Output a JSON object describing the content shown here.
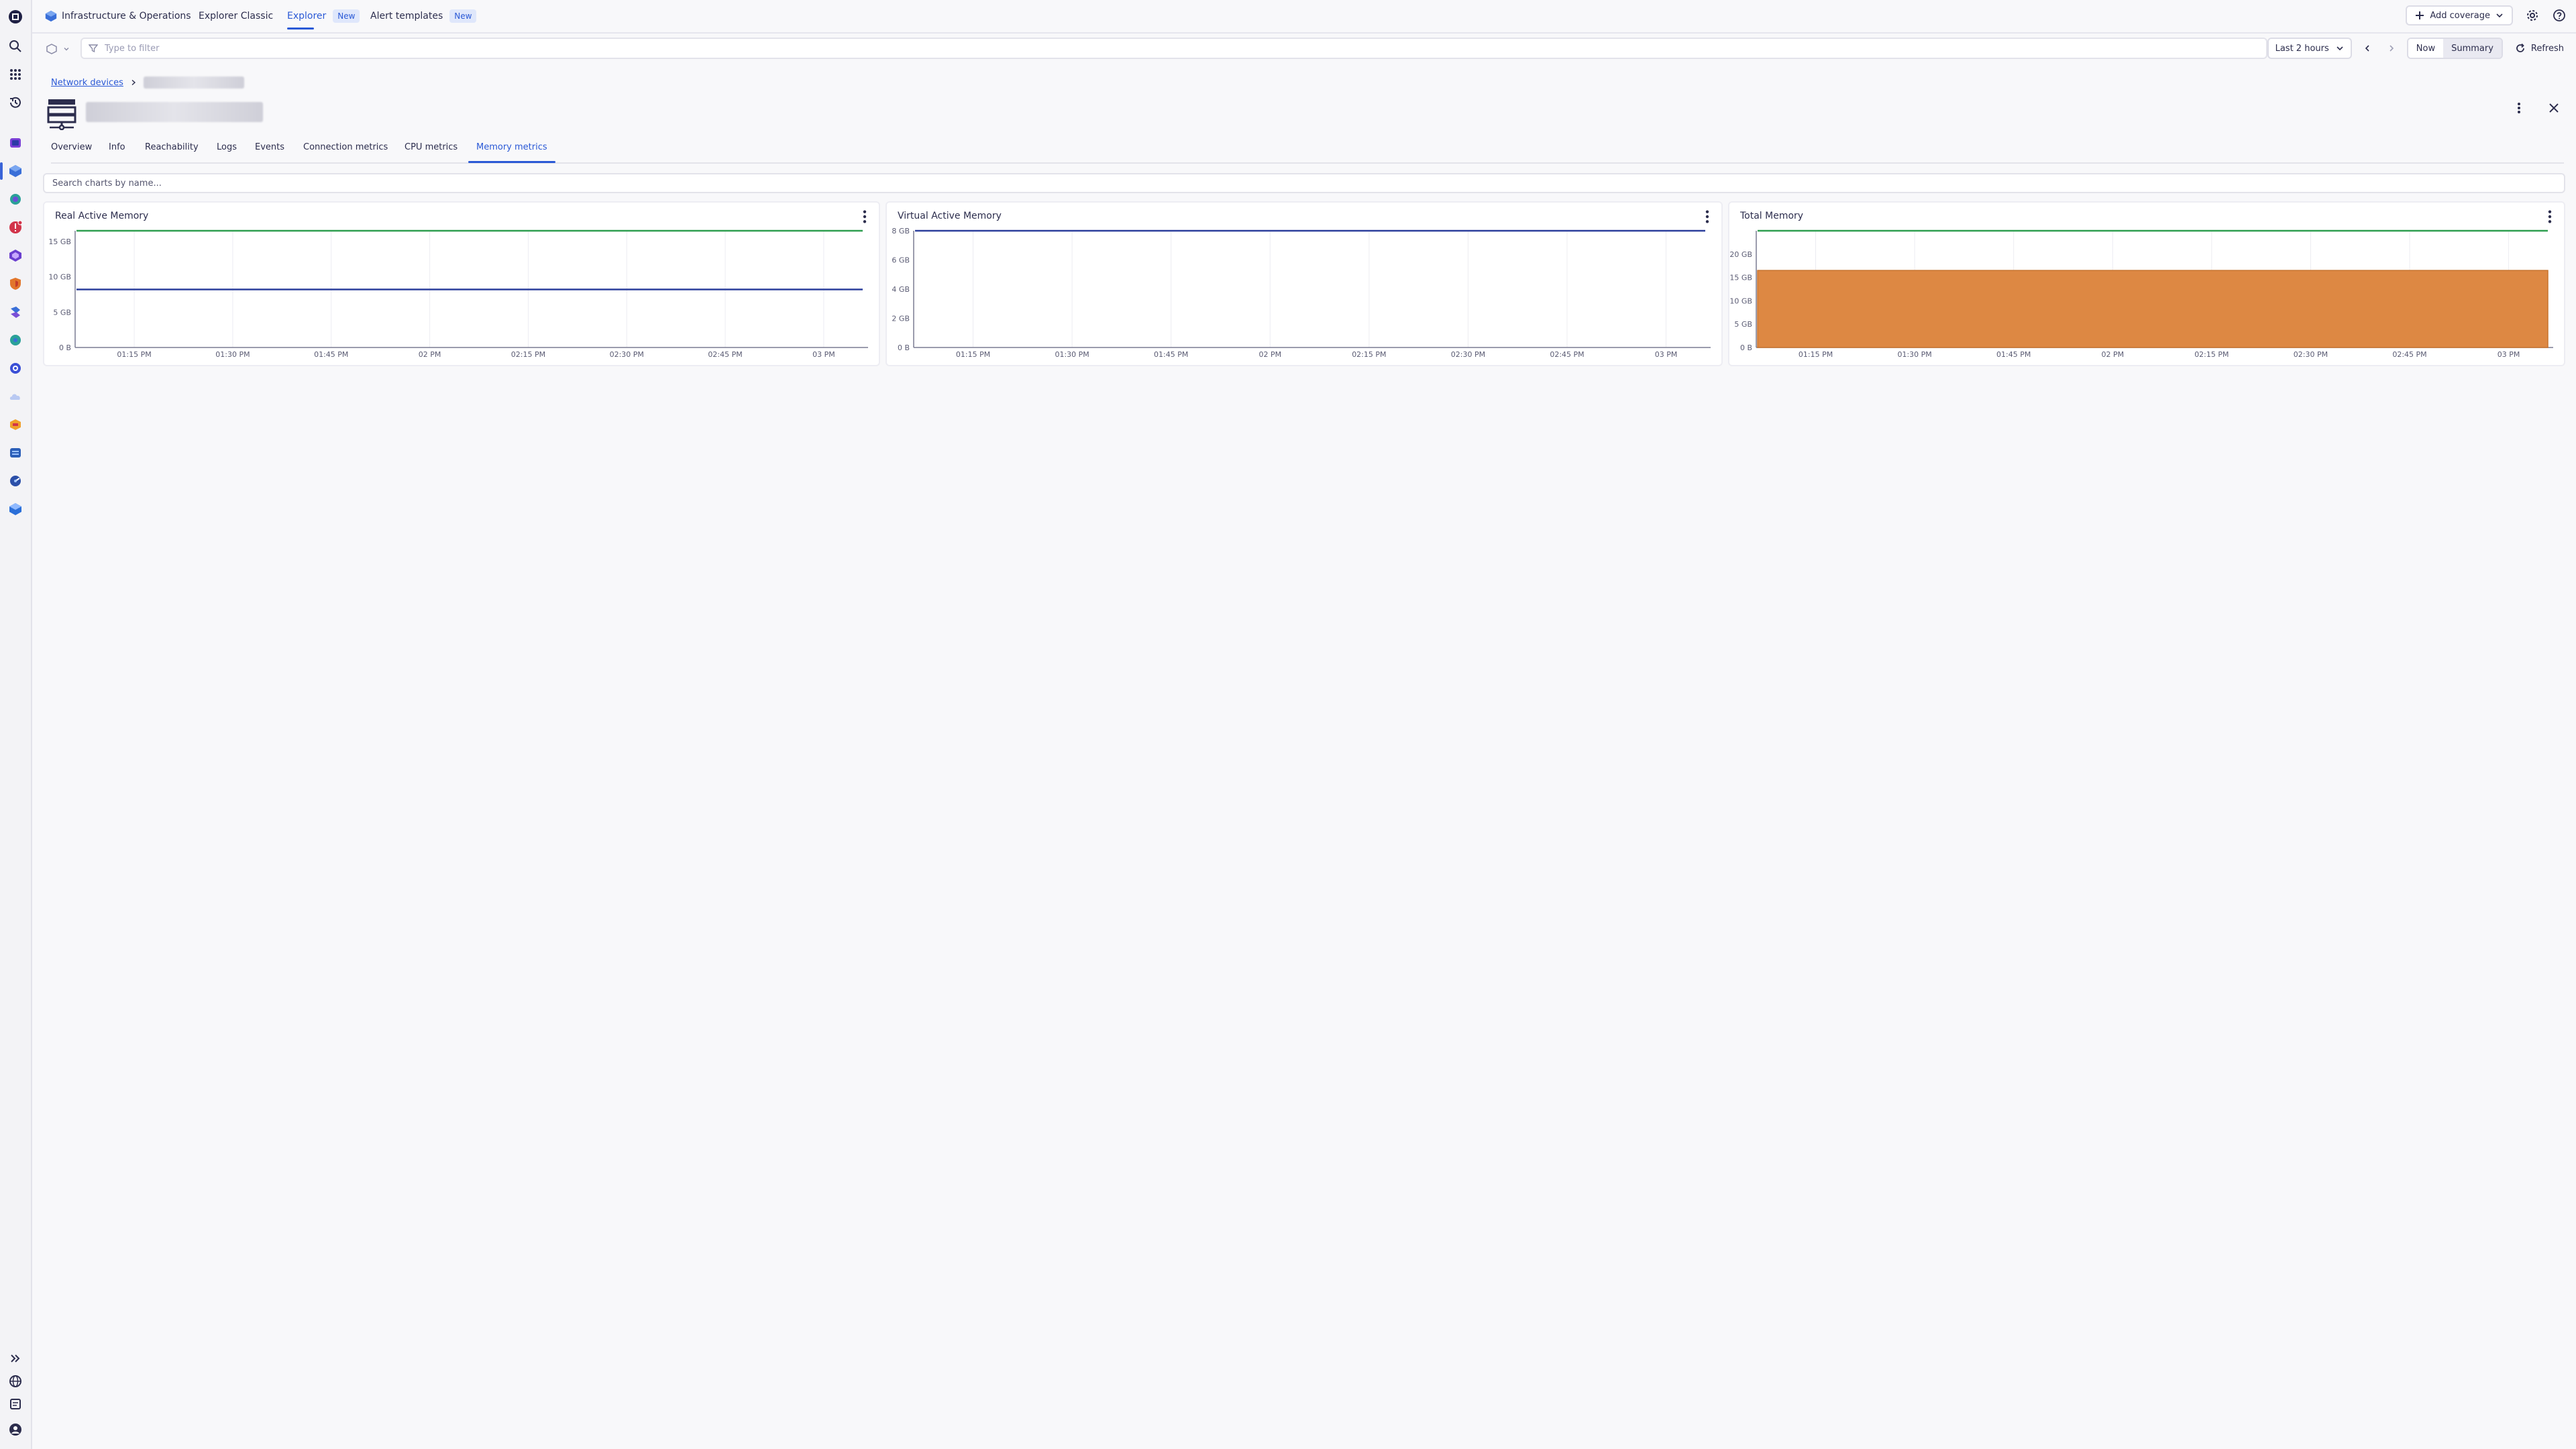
{
  "nav": {
    "app_title": "Infrastructure & Operations",
    "items": [
      {
        "label": "Explorer Classic"
      },
      {
        "label": "Explorer",
        "badge": "New"
      },
      {
        "label": "Alert templates",
        "badge": "New"
      }
    ],
    "add_coverage": "Add coverage"
  },
  "filter": {
    "placeholder": "Type to filter"
  },
  "timeframe": {
    "label": "Last 2 hours",
    "now": "Now",
    "summary": "Summary",
    "refresh": "Refresh"
  },
  "breadcrumb": {
    "parent": "Network devices"
  },
  "tabs": [
    "Overview",
    "Info",
    "Reachability",
    "Logs",
    "Events",
    "Connection metrics",
    "CPU metrics",
    "Memory metrics"
  ],
  "active_tab": "Memory metrics",
  "chart_search": {
    "placeholder": "Search charts by name..."
  },
  "colors": {
    "accent": "#2a59d6",
    "series_green": "#2e9e4f",
    "series_blue": "#2c3f9c",
    "series_orange": "#dd8843"
  },
  "chart_data": [
    {
      "type": "line",
      "title": "Real Active Memory",
      "x": [
        "01:15 PM",
        "01:30 PM",
        "01:45 PM",
        "02 PM",
        "02:15 PM",
        "02:30 PM",
        "02:45 PM",
        "03 PM"
      ],
      "yticks": [
        "15 GB",
        "10 GB",
        "5 GB",
        "0 B"
      ],
      "ylim": [
        0,
        16.5
      ],
      "series": [
        {
          "color": "#2e9e4f",
          "values": [
            16.5,
            16.5,
            16.5,
            16.5,
            16.5,
            16.5,
            16.5,
            16.5
          ]
        },
        {
          "color": "#2c3f9c",
          "values": [
            8.2,
            8.2,
            8.2,
            8.2,
            8.2,
            8.2,
            8.2,
            8.2
          ]
        }
      ]
    },
    {
      "type": "line",
      "title": "Virtual Active Memory",
      "x": [
        "01:15 PM",
        "01:30 PM",
        "01:45 PM",
        "02 PM",
        "02:15 PM",
        "02:30 PM",
        "02:45 PM",
        "03 PM"
      ],
      "yticks": [
        "8 GB",
        "6 GB",
        "4 GB",
        "2 GB",
        "0 B"
      ],
      "ylim": [
        0,
        8
      ],
      "series": [
        {
          "color": "#2c3f9c",
          "values": [
            8,
            8,
            8,
            8,
            8,
            8,
            8,
            8
          ]
        }
      ]
    },
    {
      "type": "area",
      "title": "Total Memory",
      "x": [
        "01:15 PM",
        "01:30 PM",
        "01:45 PM",
        "02 PM",
        "02:15 PM",
        "02:30 PM",
        "02:45 PM",
        "03 PM"
      ],
      "yticks": [
        "20 GB",
        "15 GB",
        "10 GB",
        "5 GB",
        "0 B"
      ],
      "ylim": [
        0,
        25
      ],
      "series": [
        {
          "color": "#2e9e4f",
          "values": [
            25,
            25,
            25,
            25,
            25,
            25,
            25,
            25
          ]
        },
        {
          "color": "#dd8843",
          "values": [
            16.5,
            16.5,
            16.5,
            16.5,
            16.5,
            16.5,
            16.5,
            16.5
          ]
        }
      ]
    }
  ]
}
